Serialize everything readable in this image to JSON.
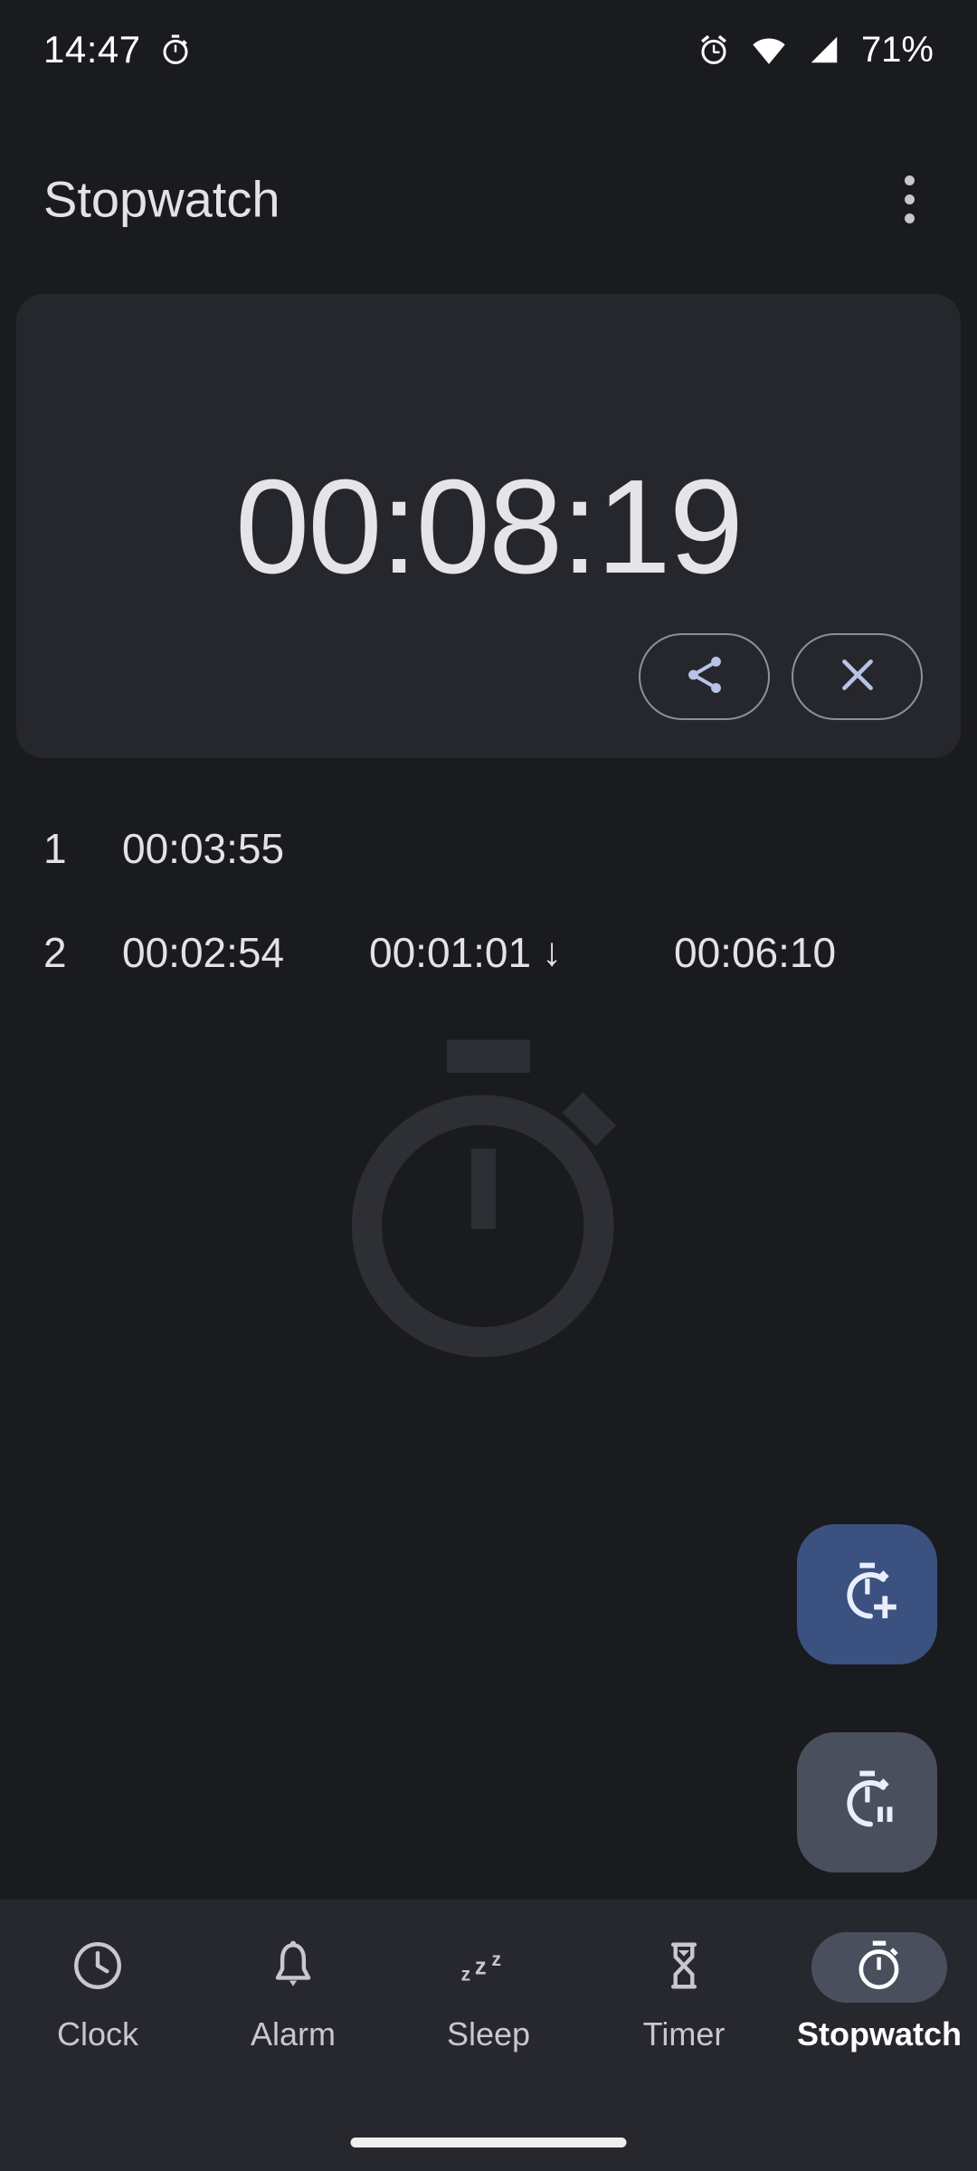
{
  "status_bar": {
    "time": "14:47",
    "battery": "71%",
    "left_icons": [
      "stopwatch-icon"
    ],
    "right_icons": [
      "alarm-icon",
      "wifi-icon",
      "signal-icon"
    ]
  },
  "app_bar": {
    "title": "Stopwatch",
    "overflow_icon": "more-vert-icon"
  },
  "timer": {
    "display": "00:08:19",
    "share_icon": "share-icon",
    "close_icon": "close-icon"
  },
  "laps": {
    "rows": [
      {
        "index": "1",
        "total": "00:03:55",
        "split": "",
        "arrow": "",
        "extra": ""
      },
      {
        "index": "2",
        "total": "00:02:54",
        "split": "00:01:01",
        "arrow": "↓",
        "extra": "00:06:10"
      }
    ]
  },
  "fabs": {
    "lap": {
      "icon": "stopwatch-add-icon",
      "color": "#3b5180"
    },
    "pause": {
      "icon": "stopwatch-pause-icon",
      "color": "#4a4f5e"
    }
  },
  "bottom_nav": {
    "items": [
      {
        "label": "Clock",
        "icon": "clock-icon",
        "active": false
      },
      {
        "label": "Alarm",
        "icon": "alarm-bell-icon",
        "active": false
      },
      {
        "label": "Sleep",
        "icon": "sleep-zzz-icon",
        "active": false
      },
      {
        "label": "Timer",
        "icon": "hourglass-icon",
        "active": false
      },
      {
        "label": "Stopwatch",
        "icon": "stopwatch-icon",
        "active": true
      }
    ]
  },
  "colors": {
    "page_bg": "#1a1b1f",
    "card_bg": "#26272d",
    "nav_bg": "#26282e",
    "accent_blue": "#3b5180",
    "icon_blue": "#b9c3e8",
    "text_primary": "#e3e2e6",
    "text_secondary": "#c8c6d0"
  }
}
